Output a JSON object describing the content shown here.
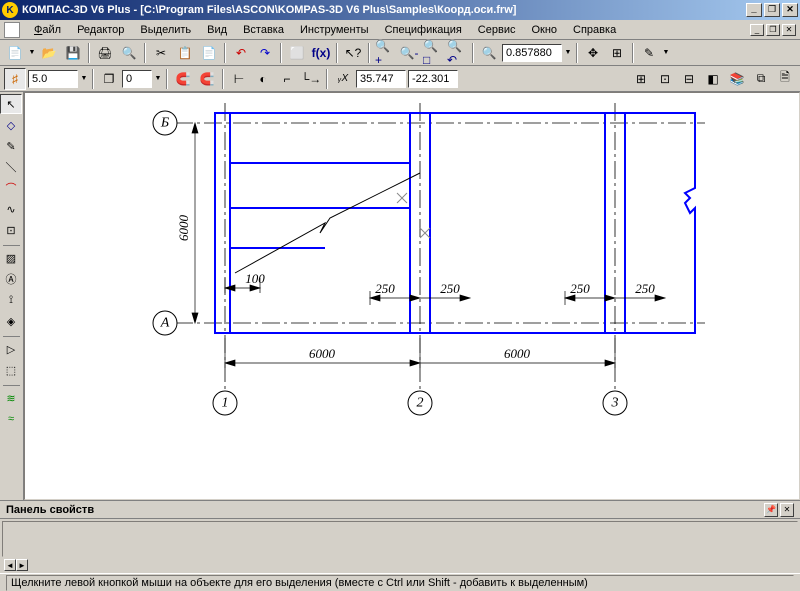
{
  "title": "КОМПАС-3D V6 Plus - [C:\\Program Files\\ASCON\\KOMPAS-3D V6 Plus\\Samples\\Коорд.оси.frw]",
  "menu": {
    "file": "Файл",
    "editor": "Редактор",
    "select": "Выделить",
    "view": "Вид",
    "insert": "Вставка",
    "tools": "Инструменты",
    "spec": "Спецификация",
    "service": "Сервис",
    "window": "Окно",
    "help": "Справка"
  },
  "toolbar1": {
    "zoom": "0.857880"
  },
  "toolbar2": {
    "step": "5.0",
    "layer": "0",
    "coord_x": "35.747",
    "coord_y": "-22.301"
  },
  "props": {
    "title": "Панель свойств"
  },
  "status": {
    "hint": "Щелкните левой кнопкой мыши на объекте для его выделения (вместе с Ctrl или Shift - добавить к выделенным)"
  },
  "drawing": {
    "dims": {
      "d6000v": "6000",
      "d100": "100",
      "d250_1": "250",
      "d250_2": "250",
      "d250_3": "250",
      "d250_4": "250",
      "d6000_1": "6000",
      "d6000_2": "6000"
    },
    "axes": {
      "A": "А",
      "B": "Б",
      "n1": "1",
      "n2": "2",
      "n3": "3"
    }
  }
}
